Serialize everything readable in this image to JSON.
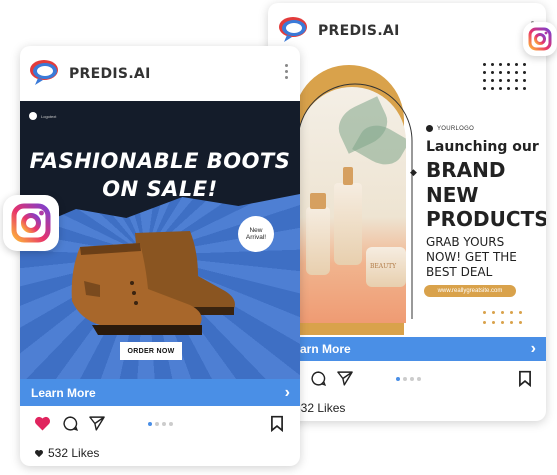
{
  "back_card": {
    "brand": "PREDIS.AI",
    "poster": {
      "logo_text": "YOURLOGO",
      "title_line1": "Launching our",
      "title_line2": "BRAND",
      "title_line3": "NEW",
      "title_line4": "PRODUCTS",
      "sub_line1": "GRAB YOURS",
      "sub_line2": "NOW! GET THE",
      "sub_line3": "BEST DEAL",
      "url": "www.reallygreatsite.com",
      "bottle_label": "BEAUTY"
    },
    "cta": "Learn More",
    "likes": "532 Likes"
  },
  "front_card": {
    "brand": "PREDIS.AI",
    "poster": {
      "logo_text": "Logotext",
      "headline_line1": "FASHIONABLE BOOTS",
      "headline_line2": "ON SALE!",
      "badge_line1": "New",
      "badge_line2": "Arrival!",
      "order_button": "ORDER NOW"
    },
    "cta": "Learn More",
    "likes": "532 Likes"
  },
  "colors": {
    "accent_blue": "#4a8fe6",
    "like_red": "#e0245e",
    "mustard": "#d9a24b"
  }
}
